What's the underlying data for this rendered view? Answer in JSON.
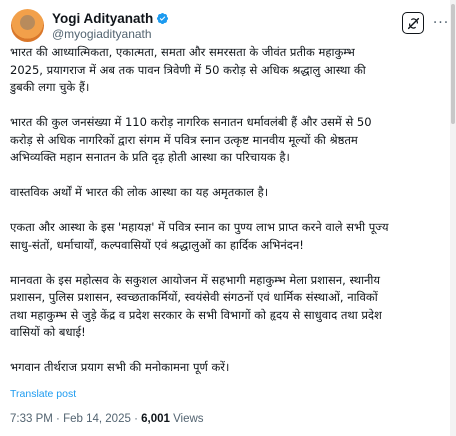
{
  "author": {
    "display_name": "Yogi Adityanath",
    "handle": "@myogiadityanath",
    "avatar_icon": "profile-avatar",
    "verified_icon": "verified-badge-icon",
    "verified_color": "#1d9bf0"
  },
  "actions": {
    "grok_icon": "grok-icon",
    "more_icon": "more-options-icon",
    "more_label": "···"
  },
  "tweet": {
    "paragraphs": [
      "भारत की आध्यात्मिकता, एकात्मता, समता और समरसता के जीवंत प्रतीक महाकुम्भ\n2025, प्रयागराज में अब तक पावन त्रिवेणी में 50 करोड़ से अधिक श्रद्धालु आस्था की\nडुबकी लगा चुके हैं।",
      "भारत की कुल जनसंख्या में 110 करोड़ नागरिक सनातन धर्मावलंबी हैं और उसमें से 50\nकरोड़ से अधिक नागरिकों द्वारा संगम में पवित्र स्नान उत्कृष्ट मानवीय मूल्यों की श्रेष्ठतम\nअभिव्यक्ति महान सनातन के प्रति दृढ़ होती आस्था का परिचायक है।",
      "वास्तविक अर्थों में भारत की लोक आस्था का यह अमृतकाल है।",
      "एकता और आस्था के इस 'महायज्ञ' में पवित्र स्नान का पुण्य लाभ प्राप्त करने वाले सभी पूज्य\nसाधु-संतों, धर्माचार्यों, कल्पवासियों एवं श्रद्धालुओं का हार्दिक अभिनंदन!",
      "मानवता के इस महोत्सव के सकुशल आयोजन में सहभागी महाकुम्भ मेला प्रशासन, स्थानीय\nप्रशासन, पुलिस प्रशासन, स्वच्छताकर्मियों, स्वयंसेवी संगठनों एवं धार्मिक संस्थाओं, नाविकों\nतथा महाकुम्भ से जुड़े केंद्र व प्रदेश सरकार के सभी विभागों को हृदय से साधुवाद तथा प्रदेश\nवासियों को बधाई!",
      "भगवान तीर्थराज प्रयाग सभी की मनोकामना पूर्ण करें।"
    ],
    "translate_label": "Translate post",
    "time": "7:33 PM",
    "separator": "·",
    "date": "Feb 14, 2025",
    "views_count": "6,001",
    "views_label": "Views"
  }
}
